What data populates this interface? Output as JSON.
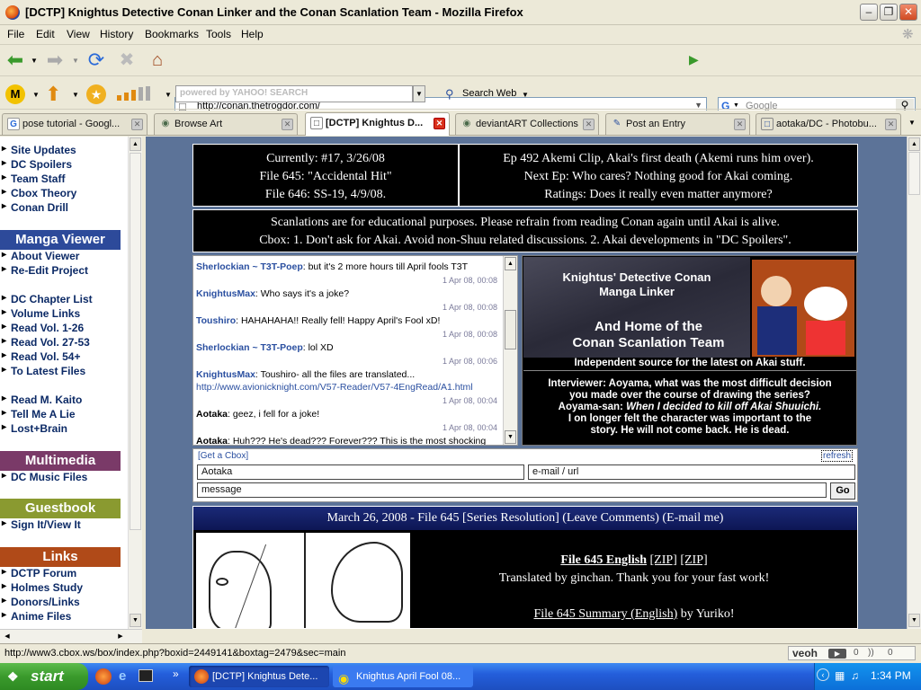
{
  "window": {
    "title": "[DCTP] Knightus Detective Conan Linker and the Conan Scanlation Team - Mozilla Firefox"
  },
  "menu": [
    "File",
    "Edit",
    "View",
    "History",
    "Bookmarks",
    "Tools",
    "Help"
  ],
  "nav": {
    "url": "http://conan.thetrogdor.com/",
    "search_engine_placeholder": "Google"
  },
  "yahoo": {
    "search_placeholder": "powered by YAHOO! SEARCH",
    "search_web_label": "Search Web"
  },
  "tabs": [
    {
      "label": "pose tutorial - Googl...",
      "icon": "G"
    },
    {
      "label": "Browse Art",
      "icon": "da"
    },
    {
      "label": "[DCTP] Knightus D...",
      "icon": "dc",
      "active": true
    },
    {
      "label": "deviantART Collections",
      "icon": "da"
    },
    {
      "label": "Post an Entry",
      "icon": "pen"
    },
    {
      "label": "aotaka/DC - Photobu...",
      "icon": "pb"
    }
  ],
  "sidebar": {
    "group1": [
      "Site Updates",
      "DC Spoilers",
      "Team Staff",
      "Cbox Theory",
      "Conan Drill"
    ],
    "manga_header": "Manga Viewer",
    "group2": [
      "About Viewer",
      "Re-Edit Project"
    ],
    "group3": [
      "DC Chapter List",
      "Volume Links",
      "Read Vol. 1-26",
      "Read Vol. 27-53",
      "Read Vol. 54+",
      "To Latest Files"
    ],
    "group4": [
      "Read M. Kaito",
      "Tell Me A Lie",
      "Lost+Brain"
    ],
    "multimedia_header": "Multimedia",
    "group5": [
      "DC Music Files"
    ],
    "guestbook_header": "Guestbook",
    "group6": [
      "Sign It/View It"
    ],
    "links_header": "Links",
    "group7": [
      "DCTP Forum",
      "Holmes Study",
      "Donors/Links",
      "Anime Files"
    ]
  },
  "info": {
    "left": [
      "Currently: #17, 3/26/08",
      "File 645: \"Accidental Hit\"",
      "File 646: SS-19, 4/9/08."
    ],
    "right": [
      "Ep 492 Akemi Clip, Akai's first death (Akemi runs him over).",
      "Next Ep: Who cares? Nothing good for Akai coming.",
      "Ratings: Does it really even matter anymore?"
    ],
    "notice": [
      "Scanlations are for educational purposes. Please refrain from reading Conan again until Akai is alive.",
      "Cbox: 1. Don't ask for Akai. Avoid non-Shuu related discussions. 2. Akai developments in \"DC Spoilers\"."
    ]
  },
  "chat": {
    "messages": [
      {
        "user": "Sherlockian ~ T3T-Poep",
        "text": ": but it's 2 more hours till April fools T3T",
        "date": "1 Apr 08, 00:08"
      },
      {
        "user": "KnightusMax",
        "text": ": Who says it's a joke?",
        "date": "1 Apr 08, 00:08"
      },
      {
        "user": "Toushiro",
        "text": ": HAHAHAHA!! Really fell! Happy April's Fool xD!",
        "date": "1 Apr 08, 00:08"
      },
      {
        "user": "Sherlockian ~ T3T-Poep",
        "text": ": lol XD",
        "date": "1 Apr 08, 00:06"
      },
      {
        "user": "KnightusMax",
        "text": ": Toushiro- all the files are translated...",
        "date": ""
      },
      {
        "user": "",
        "text": "http://www.avionicknight.com/V57-Reader/V57-4EngRead/A1.html",
        "date": "1 Apr 08, 00:04"
      },
      {
        "user": "Aotaka",
        "text": ": geez, i fell for a joke!",
        "date": "1 Apr 08, 00:04"
      },
      {
        "user": "Aotaka",
        "text": ": Huh??? He's dead??? Forever??? This is the most shocking",
        "date": ""
      }
    ]
  },
  "banner": {
    "line1": "Knightus' Detective Conan",
    "line2": "Manga Linker",
    "line3": "And Home of the",
    "line4": "Conan Scanlation Team",
    "tagline": "Independent source for the latest on Akai stuff.",
    "q1": "Interviewer: Aoyama, what was the most difficult decision",
    "q2": "you made over the course of drawing the series?",
    "a1_label": "Aoyama-san: ",
    "a1": "When I decided to kill off Akai Shuuichi.",
    "a2": "I on longer felt the character was important to the",
    "a3": "story. He will not come back. He is dead."
  },
  "cbox": {
    "get": "[Get a Cbox]",
    "refresh": "refresh",
    "name": "Aotaka",
    "email": "e-mail / url",
    "message": "message",
    "go": "Go"
  },
  "post": {
    "header": "March 26, 2008 - File 645 [Series Resolution] (Leave Comments) (E-mail me)",
    "link1": "File 645 English",
    "zip1": "[ZIP]",
    "zip2": "[ZIP]",
    "credit": "Translated by ginchan. Thank you for your fast work!",
    "summary_link": "File 645 Summary (English)",
    "summary_by": " by Yuriko!"
  },
  "status": {
    "url": "http://www3.cbox.ws/box/index.php?boxid=2449141&boxtag=2479&sec=main",
    "veoh": "veoh",
    "c1": "0",
    "c2": "0"
  },
  "taskbar": {
    "start": "start",
    "tasks": [
      "[DCTP] Knightus Dete...",
      "Knightus April Fool 08..."
    ],
    "clock": "1:34 PM"
  },
  "colors": {
    "manga_header": "#2d4a9a",
    "multimedia_header": "#7a3a68",
    "guestbook_header": "#8a9a30",
    "links_header": "#b04a18",
    "page_bg": "#5c7398"
  }
}
